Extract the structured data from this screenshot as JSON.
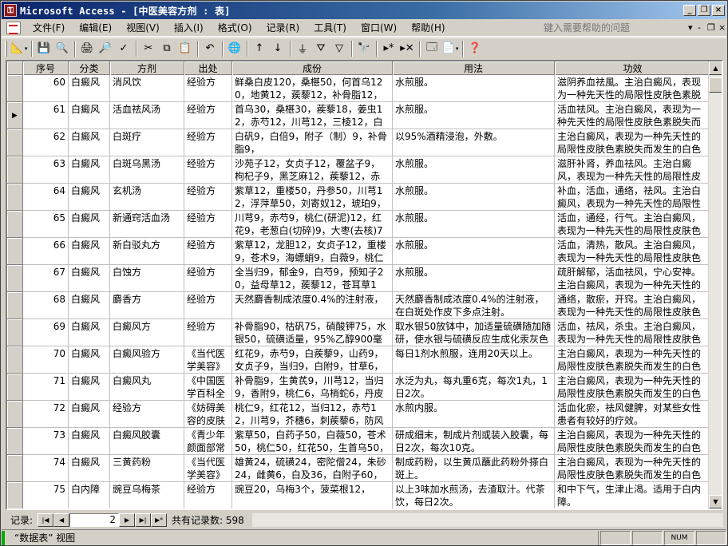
{
  "window": {
    "title": "Microsoft Access - [中医美容方剂 : 表]",
    "minimize": "_",
    "restore": "❐",
    "close": "×"
  },
  "menu": {
    "items": [
      "文件(F)",
      "编辑(E)",
      "视图(V)",
      "插入(I)",
      "格式(O)",
      "记录(R)",
      "工具(T)",
      "窗口(W)",
      "帮助(H)"
    ],
    "help_placeholder": "键入需要帮助的问题",
    "mdi_buttons": [
      "▾",
      "-",
      "❐",
      "×"
    ]
  },
  "table": {
    "columns": [
      "序号",
      "分类",
      "方剂",
      "出处",
      "成份",
      "用法",
      "功效"
    ],
    "current_row_index": 1,
    "rows": [
      [
        "60",
        "白癜风",
        "消风饮",
        "经验方",
        "鲜桑白皮120，桑椹50，何首乌120，地黄12，蒺藜12，补骨脂12，益母草",
        "水煎服。",
        "滋阴养血祛風。主治白癜风，表现为一种先天性的局限性皮肤色素脱失而"
      ],
      [
        "61",
        "白癜风",
        "活血祛风汤",
        "经验方",
        "首乌30，桑椹30，蒺藜18，姜虫12，赤芍12，川芎12，三棱12，白术12",
        "水煎服。",
        "活血祛风。主治白癜风，表现为一种先天性的局限性皮肤色素脱失而发生"
      ],
      [
        "62",
        "白癜风",
        "白斑疗",
        "经验方",
        "白矾9，白倍9，附子（制）9，补骨脂9，",
        "以95%酒精浸泡，外敷。",
        "主治白癜风，表现为一种先天性的局限性皮肤色素脱失而发生的白色斑片"
      ],
      [
        "63",
        "白癜风",
        "白斑乌黑汤",
        "经验方",
        "沙苑子12，女贞子12，覆盆子9，枸杞子9，黑芝麻12，蒺藜12，赤芍9，",
        "水煎服。",
        "滋肝补肾，养血祛风。主治白癜风，表现为一种先天性的局限性皮肤色素"
      ],
      [
        "64",
        "白癜风",
        "玄机汤",
        "经验方",
        "紫草12，重楼50，丹参50，川芎12，浮萍草50，刘寄奴12，琥珀9，地龙",
        "水煎服。",
        "补血，活血，通络，祛风。主治白癜风，表现为一种先天性的局限性皮肤"
      ],
      [
        "65",
        "白癜风",
        "新通窍活血汤",
        "经验方",
        "川芎9，赤芍9，桃仁(研泥)12，红花9，老葱白(切碎)9，大枣(去核)7",
        "水煎服。",
        "活血，通经，行气。主治白癜风，表现为一种先天性的局限性皮肤色素脱"
      ],
      [
        "66",
        "白癜风",
        "新白驳丸方",
        "经验方",
        "紫草12，龙胆12，女贞子12，重楼9，苍术9，海螵蛸9，白薇9，桃仁",
        "水煎服。",
        "活血，清热，散风。主治白癜风，表现为一种先天性的局限性皮肤色素脱"
      ],
      [
        "67",
        "白癜风",
        "白蚀方",
        "经验方",
        "全当归9，郁金9，白芍9，预知子20，益母草12，蒺藜12，苍耳草12，",
        "水煎服。",
        "疏肝解郁，活血祛风，宁心安神。主治白癜风，表现为一种先天性的局限"
      ],
      [
        "68",
        "白癜风",
        "麝香方",
        "经验方",
        "天然麝香制成浓度0.4%的注射液，",
        "天然麝香制成浓度0.4%的注射液，在白斑处作皮下多点注射。",
        "通络，散瘀，开窍。主治白癜风，表现为一种先天性的局限性皮肤色素脱"
      ],
      [
        "69",
        "白癜风",
        "白癜风方",
        "经验方",
        "补骨脂90，枯矾75，硝酸钾75，水银50，硫磺适量，95%乙醇900毫升，",
        "取水银50放钵中，加适量硫磺随加随研，使水银与硫磺反应生成化汞灰色",
        "活血，祛风，杀虫。主治白癜风，表现为一种先天性的局限性皮肤色素脱"
      ],
      [
        "70",
        "白癜风",
        "白癜风验方",
        "《当代医学美容》",
        "红花9，赤芍9，白蒺藜9，山药9，女贞子9，当归9，白附9，甘草6，",
        "每日1剂水煎服，连用20天以上。",
        "主治白癜风，表现为一种先天性的局限性皮肤色素脱失而发生的白色斑片"
      ],
      [
        "71",
        "白癜风",
        "白癜风丸",
        "《中国医学百科全",
        "补骨脂9，生黄芪9，川芎12，当归9，香附9，桃仁6，乌梢蛇6，丹皮",
        "水泛为丸，每丸重6克，每次1丸，1日2次。",
        "主治白癜风，表现为一种先天性的局限性皮肤色素脱失而发生的白色斑片"
      ],
      [
        "72",
        "白癜风",
        "经验方",
        "《妨碍美容的皮肤",
        "桃仁9，红花12，当归12，赤芍12，川芎9，芥穗6，刺蒺藜6，防风9，白",
        "水煎内服。",
        "活血化瘀，祛风健脾，对某些女性患者有较好的疗效。"
      ],
      [
        "73",
        "白癜风",
        "白癜风胶囊",
        "《青少年颜面部常",
        "紫草50，白药子50，白薇50，苍术50，桃仁50，红花50，生首乌50，刺",
        "研成细末，制成片剂或装入胶囊，每日2次，每次10克。",
        "主治白癜风，表现为一种先天性的局限性皮肤色素脱失而发生的白色斑片"
      ],
      [
        "74",
        "白癜风",
        "三黄药粉",
        "《当代医学美容》",
        "雄黄24，硫磺24，密陀僧24，朱砂24，雌黄6，白及36，白附子60，冰",
        "制成药粉，以生黄瓜蘸此药粉外搽白斑上。",
        "主治白癜风，表现为一种先天性的局限性皮肤色素脱失而发生的白色斑片"
      ],
      [
        "75",
        "白内障",
        "豌豆乌梅茶",
        "经验方",
        "豌豆20，乌梅3个，菠菜根12，",
        "以上3味加水煎汤，去渣取汁。代茶饮，每日2次。",
        "和中下气，生津止渴。适用于白内障。"
      ],
      [
        "76",
        "白内障",
        "黄耆鲜胡芹",
        "经验方",
        "白蒺藜15，鲜芹12，鲜芹汁",
        "以上2味加水煎汤，去渣取汁。代茶",
        "清热解毒，健脾利水。适用于白内"
      ]
    ]
  },
  "navigation": {
    "label": "记录:",
    "current_record": "2",
    "total_text": "共有记录数: 598"
  },
  "status": {
    "text": "“数据表” 视图",
    "num_indicator": "NUM"
  }
}
